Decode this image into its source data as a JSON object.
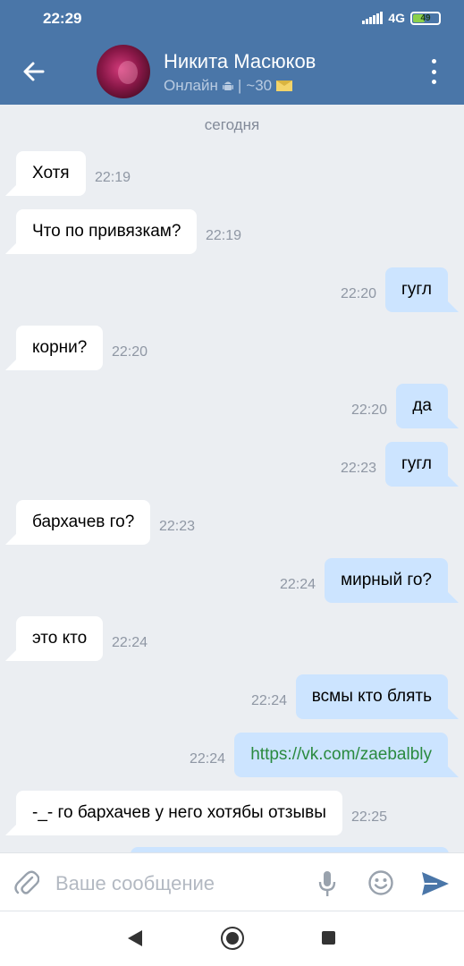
{
  "status_bar": {
    "time": "22:29",
    "network": "4G",
    "battery": "49",
    "battery_level": 0.49
  },
  "header": {
    "name": "Никита Масюков",
    "status": "Онлайн",
    "separator": "|",
    "last_seen": "~30"
  },
  "chat": {
    "date_separator": "сегодня",
    "messages": [
      {
        "dir": "in",
        "text": "Хотя",
        "time": "22:19"
      },
      {
        "dir": "in",
        "text": "Что по привязкам?",
        "time": "22:19"
      },
      {
        "dir": "out",
        "text": "гугл",
        "time": "22:20"
      },
      {
        "dir": "in",
        "text": "корни?",
        "time": "22:20"
      },
      {
        "dir": "out",
        "text": "да",
        "time": "22:20"
      },
      {
        "dir": "out",
        "text": "гугл",
        "time": "22:23"
      },
      {
        "dir": "in",
        "text": "бархачев го?",
        "time": "22:23"
      },
      {
        "dir": "out",
        "text": "мирный го?",
        "time": "22:24"
      },
      {
        "dir": "in",
        "text": "это кто",
        "time": "22:24"
      },
      {
        "dir": "out",
        "text": "всмы кто блять",
        "time": "22:24"
      },
      {
        "dir": "out",
        "text": "https://vk.com/zaebalbly",
        "time": "22:24",
        "link": true
      },
      {
        "dir": "in",
        "text": "-_- го бархачев у него хотябы отзывы",
        "time": "22:25"
      }
    ]
  },
  "composer": {
    "placeholder": "Ваше сообщение"
  },
  "icons": {
    "back": "arrow-left-icon",
    "menu": "more-vertical-icon",
    "android": "android-icon",
    "envelope": "envelope-icon",
    "attach": "paperclip-icon",
    "mic": "microphone-icon",
    "emoji": "smile-icon",
    "send": "send-icon"
  },
  "colors": {
    "header": "#4a76a8",
    "incoming_bubble": "#ffffff",
    "outgoing_bubble": "#cce4ff",
    "chat_background": "#ebeef2",
    "link": "#2a8a3f",
    "send": "#4a76a8"
  }
}
